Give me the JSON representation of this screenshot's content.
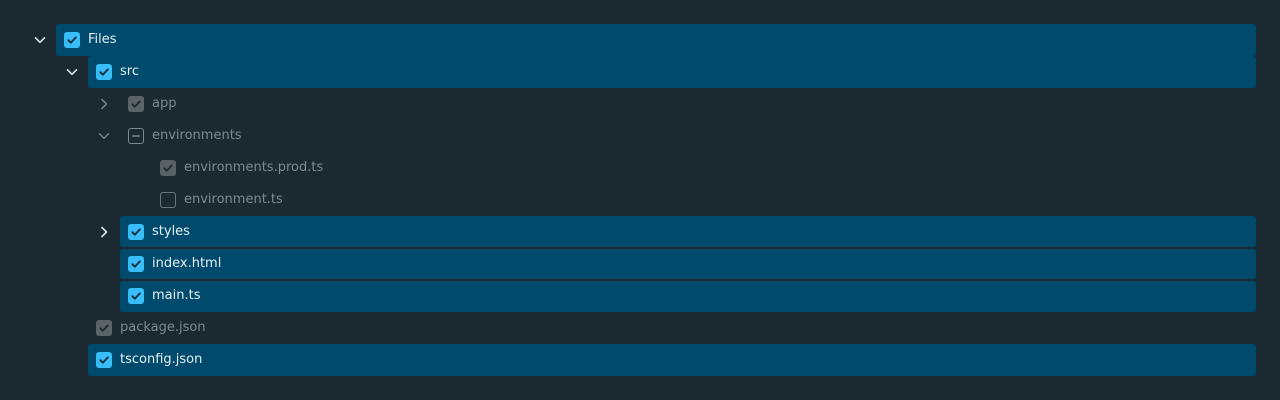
{
  "tree": {
    "items": [
      {
        "label": "Files",
        "state": "checked",
        "expanded": true,
        "selected": true
      },
      {
        "label": "src",
        "state": "checked",
        "expanded": true,
        "selected": true
      },
      {
        "label": "app",
        "state": "checked",
        "expanded": false,
        "selected": false
      },
      {
        "label": "environments",
        "state": "indeterminate",
        "expanded": true,
        "selected": false
      },
      {
        "label": "environments.prod.ts",
        "state": "checked",
        "selected": false
      },
      {
        "label": "environment.ts",
        "state": "unchecked",
        "selected": false
      },
      {
        "label": "styles",
        "state": "checked",
        "expanded": false,
        "selected": true
      },
      {
        "label": "index.html",
        "state": "checked",
        "selected": true
      },
      {
        "label": "main.ts",
        "state": "checked",
        "selected": true
      },
      {
        "label": "package.json",
        "state": "checked",
        "selected": false
      },
      {
        "label": "tsconfig.json",
        "state": "checked",
        "selected": true
      }
    ]
  },
  "icons": {
    "expanded": "chevron-down-icon",
    "collapsed": "chevron-right-icon",
    "checked": "check-icon",
    "indeterminate": "minus-icon"
  },
  "colors": {
    "background": "#1b2a31",
    "selection": "#004b6d",
    "checkbox_checked": "#38bdf8",
    "checkbox_checked_unselected": "#5c6469",
    "text_selected": "#e6edf0",
    "text_unselected": "#7f898e"
  }
}
